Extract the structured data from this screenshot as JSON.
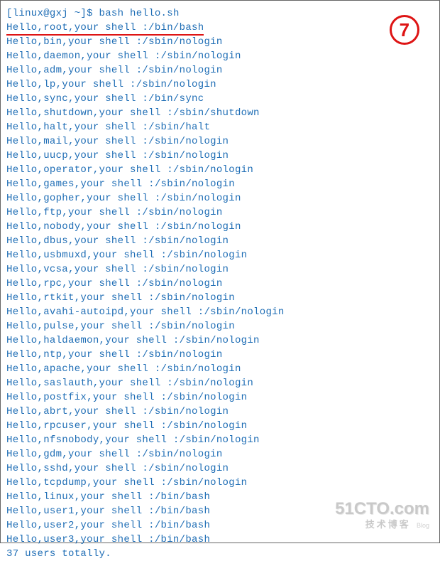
{
  "prompt": {
    "user_host": "[linux@gxj ~]$",
    "command": "bash hello.sh"
  },
  "highlighted_line": "Hello,root,your shell :/bin/bash",
  "lines": [
    "Hello,bin,your shell :/sbin/nologin",
    "Hello,daemon,your shell :/sbin/nologin",
    "Hello,adm,your shell :/sbin/nologin",
    "Hello,lp,your shell :/sbin/nologin",
    "Hello,sync,your shell :/bin/sync",
    "Hello,shutdown,your shell :/sbin/shutdown",
    "Hello,halt,your shell :/sbin/halt",
    "Hello,mail,your shell :/sbin/nologin",
    "Hello,uucp,your shell :/sbin/nologin",
    "Hello,operator,your shell :/sbin/nologin",
    "Hello,games,your shell :/sbin/nologin",
    "Hello,gopher,your shell :/sbin/nologin",
    "Hello,ftp,your shell :/sbin/nologin",
    "Hello,nobody,your shell :/sbin/nologin",
    "Hello,dbus,your shell :/sbin/nologin",
    "Hello,usbmuxd,your shell :/sbin/nologin",
    "Hello,vcsa,your shell :/sbin/nologin",
    "Hello,rpc,your shell :/sbin/nologin",
    "Hello,rtkit,your shell :/sbin/nologin",
    "Hello,avahi-autoipd,your shell :/sbin/nologin",
    "Hello,pulse,your shell :/sbin/nologin",
    "Hello,haldaemon,your shell :/sbin/nologin",
    "Hello,ntp,your shell :/sbin/nologin",
    "Hello,apache,your shell :/sbin/nologin",
    "Hello,saslauth,your shell :/sbin/nologin",
    "Hello,postfix,your shell :/sbin/nologin",
    "Hello,abrt,your shell :/sbin/nologin",
    "Hello,rpcuser,your shell :/sbin/nologin",
    "Hello,nfsnobody,your shell :/sbin/nologin",
    "Hello,gdm,your shell :/sbin/nologin",
    "Hello,sshd,your shell :/sbin/nologin",
    "Hello,tcpdump,your shell :/sbin/nologin",
    "Hello,linux,your shell :/bin/bash",
    "Hello,user1,your shell :/bin/bash",
    "Hello,user2,your shell :/bin/bash",
    "Hello,user3,your shell :/bin/bash",
    "37 users totally."
  ],
  "badge": "7",
  "watermark": {
    "line1": "51CTO.com",
    "line2": "技术博客",
    "tag": "Blog"
  }
}
